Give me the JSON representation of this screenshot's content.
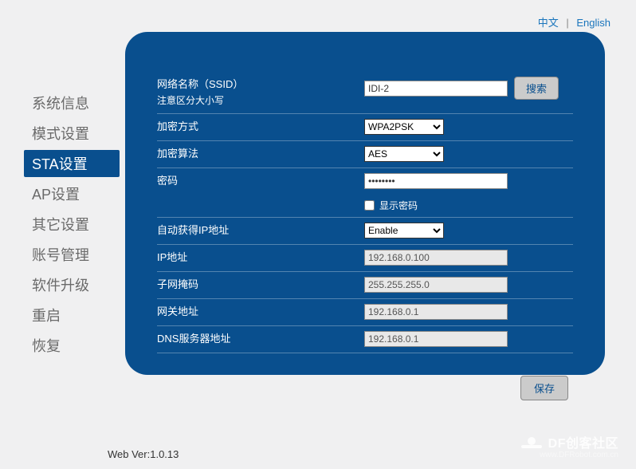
{
  "lang": {
    "chinese": "中文",
    "english": "English"
  },
  "sidebar": {
    "items": [
      {
        "label": "系统信息"
      },
      {
        "label": "模式设置"
      },
      {
        "label": "STA设置"
      },
      {
        "label": "AP设置"
      },
      {
        "label": "其它设置"
      },
      {
        "label": "账号管理"
      },
      {
        "label": "软件升级"
      },
      {
        "label": "重启"
      },
      {
        "label": "恢复"
      }
    ],
    "activeIndex": 2
  },
  "form": {
    "ssid_label": "网络名称（SSID）",
    "ssid_note": "注意区分大小写",
    "ssid_value": "IDI-2",
    "search_btn": "搜索",
    "enc_mode_label": "加密方式",
    "enc_mode_value": "WPA2PSK",
    "enc_algo_label": "加密算法",
    "enc_algo_value": "AES",
    "password_label": "密码",
    "password_value": "••••••••",
    "show_password_label": "显示密码",
    "auto_ip_label": "自动获得IP地址",
    "auto_ip_value": "Enable",
    "ip_label": "IP地址",
    "ip_value": "192.168.0.100",
    "mask_label": "子网掩码",
    "mask_value": "255.255.255.0",
    "gateway_label": "网关地址",
    "gateway_value": "192.168.0.1",
    "dns_label": "DNS服务器地址",
    "dns_value": "192.168.0.1",
    "save_btn": "保存"
  },
  "version": "Web Ver:1.0.13",
  "watermark": {
    "title": "DF创客社区",
    "url": "www.DFRobot.com.cn"
  }
}
